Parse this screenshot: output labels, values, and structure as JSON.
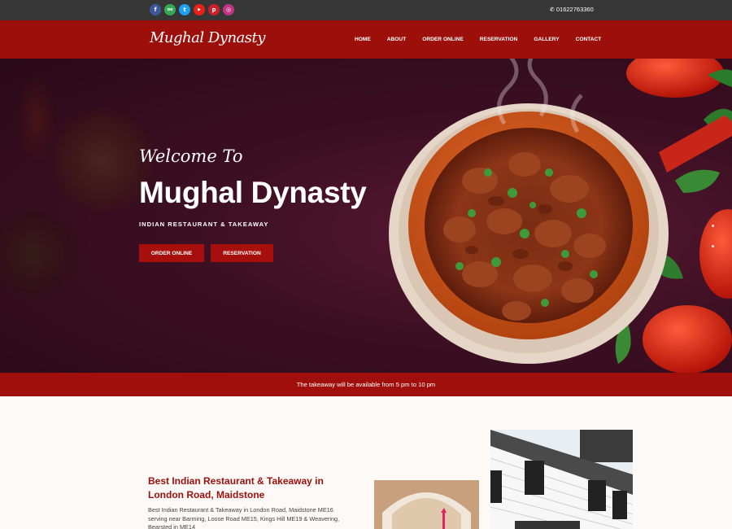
{
  "topbar": {
    "social": [
      {
        "name": "facebook",
        "glyph": "f",
        "color": "#3b5998"
      },
      {
        "name": "tripadvisor",
        "glyph": "oo",
        "color": "#34a853"
      },
      {
        "name": "twitter",
        "glyph": "t",
        "color": "#1da1f2"
      },
      {
        "name": "youtube",
        "glyph": "▶",
        "color": "#e62117"
      },
      {
        "name": "pinterest",
        "glyph": "p",
        "color": "#cb2027"
      },
      {
        "name": "instagram",
        "glyph": "◎",
        "color": "#c13584"
      }
    ],
    "phone_icon": "✆",
    "phone": "01622763360"
  },
  "header": {
    "logo": "Mughal Dynasty",
    "nav": [
      "HOME",
      "ABOUT",
      "ORDER ONLINE",
      "RESERVATION",
      "GALLERY",
      "CONTACT"
    ]
  },
  "hero": {
    "welcome": "Welcome To",
    "title": "Mughal Dynasty",
    "subtitle": "INDIAN RESTAURANT & TAKEAWAY",
    "buttons": {
      "order": "ORDER ONLINE",
      "reservation": "RESERVATION"
    }
  },
  "notice": "The takeaway will be available from 5 pm to 10 pm",
  "about": {
    "heading": "Best Indian Restaurant & Takeaway in London Road, Maidstone",
    "text": "Best Indian Restaurant & Takeaway in London Road, Maidstone ME16 serving near Barming, Loose Road ME15, Kings Hill ME19 & Weavering, Bearsted in ME14"
  },
  "colors": {
    "brand_red": "#9c0f0b",
    "topbar": "#363636",
    "hero_bg": "#3c0f22"
  }
}
